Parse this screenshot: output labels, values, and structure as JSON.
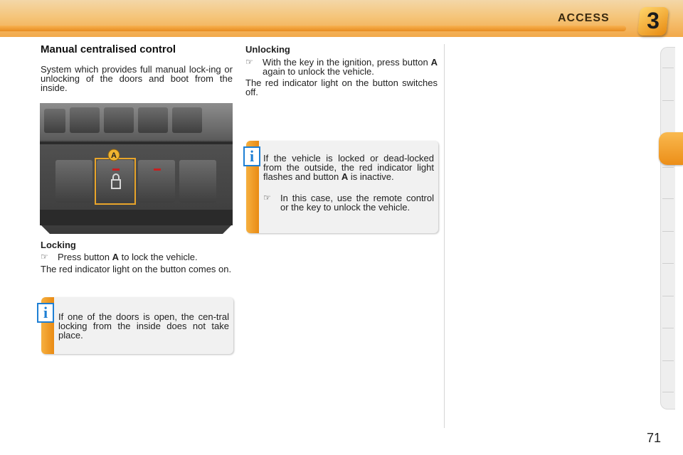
{
  "header": {
    "title": "ACCESS",
    "chapter": "3"
  },
  "left": {
    "title": "Manual centralised control",
    "intro": "System which provides full manual lock-ing or unlocking of the doors and boot from the inside.",
    "locking": {
      "heading": "Locking",
      "bullet_pre": "Press button ",
      "bullet_key": "A",
      "bullet_post": " to lock the vehicle.",
      "after": "The red indicator light on the button comes on."
    },
    "info": "If one of the doors is open, the cen-tral locking from the inside does not take place.",
    "photo_label": "A"
  },
  "right": {
    "unlocking": {
      "heading": "Unlocking",
      "bullet_pre": "With the key in the ignition, press button ",
      "bullet_key": "A",
      "bullet_post": " again to unlock the vehicle.",
      "after": "The red indicator light on the button switches off."
    },
    "info": {
      "text_pre": "If the vehicle is locked or dead-locked from the outside, the red indicator light flashes and button ",
      "text_key": "A",
      "text_post": " is inactive.",
      "bullet": "In this case, use the remote control or the key to unlock the vehicle."
    }
  },
  "info_icon": "i",
  "bullet_icon": "pointing-hand-icon",
  "page_number": "71",
  "colors": {
    "accent": "#f2a13a",
    "info_icon": "#1e7fd4"
  }
}
